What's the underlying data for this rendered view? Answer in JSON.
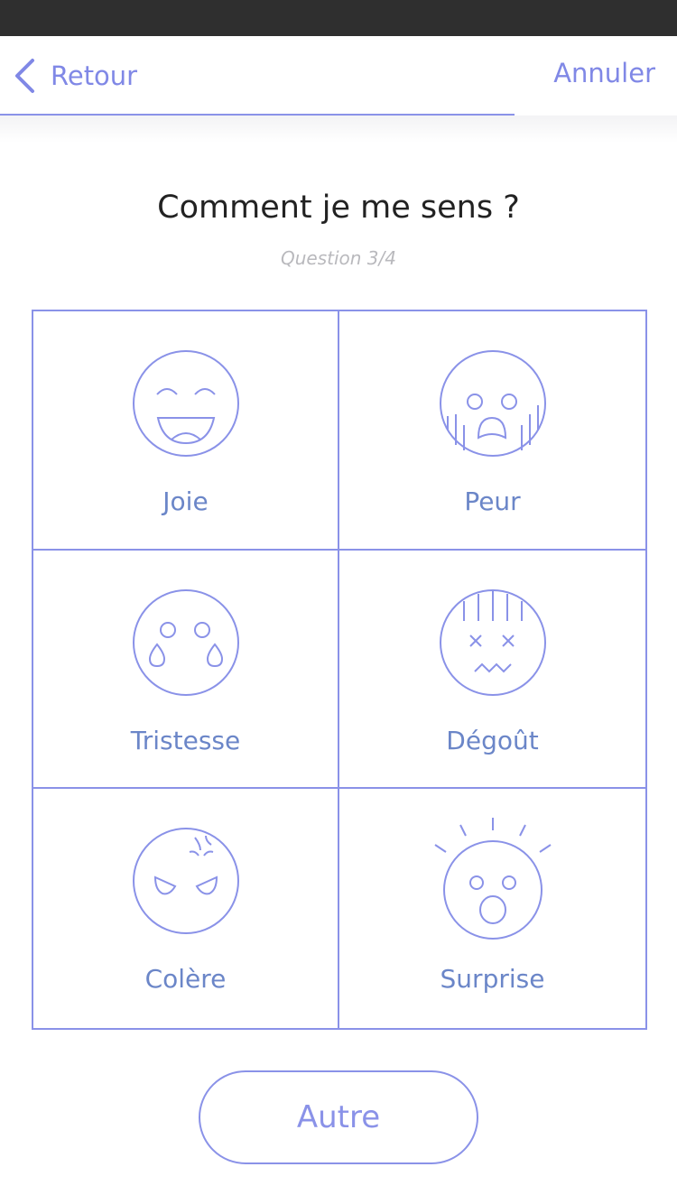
{
  "nav": {
    "back_label": "Retour",
    "cancel_label": "Annuler",
    "progress": 0.76
  },
  "header": {
    "title": "Comment je me sens ?",
    "subtitle": "Question  3/4"
  },
  "emotions": [
    {
      "label": "Joie",
      "icon": "joy-face-icon"
    },
    {
      "label": "Peur",
      "icon": "fear-face-icon"
    },
    {
      "label": "Tristesse",
      "icon": "sad-face-icon"
    },
    {
      "label": "Dégoût",
      "icon": "disgust-face-icon"
    },
    {
      "label": "Colère",
      "icon": "angry-face-icon"
    },
    {
      "label": "Surprise",
      "icon": "surprise-face-icon"
    }
  ],
  "footer": {
    "other_label": "Autre"
  },
  "colors": {
    "accent": "#8a92e8",
    "label": "#6b86c8",
    "status_bar": "#2f2f2f"
  }
}
